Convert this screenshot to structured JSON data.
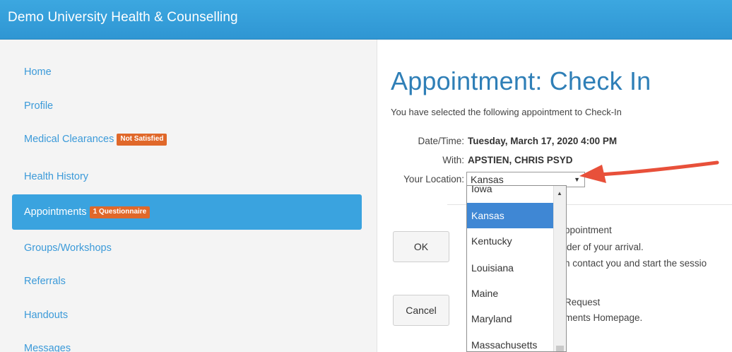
{
  "header": {
    "title": "Demo University Health & Counselling"
  },
  "sidebar": {
    "items": [
      {
        "label": "Home",
        "badge": ""
      },
      {
        "label": "Profile",
        "badge": ""
      },
      {
        "label": "Medical Clearances",
        "badge": "Not Satisfied"
      },
      {
        "label": "Health History",
        "badge": ""
      },
      {
        "label": "Appointments",
        "badge": "1 Questionnaire",
        "active": true
      },
      {
        "label": "Groups/Workshops",
        "badge": ""
      },
      {
        "label": "Referrals",
        "badge": ""
      },
      {
        "label": "Handouts",
        "badge": ""
      },
      {
        "label": "Messages",
        "badge": ""
      }
    ]
  },
  "main": {
    "title": "Appointment: Check In",
    "intro": "You have selected the following appointment to Check-In",
    "datetime_label": "Date/Time:",
    "datetime_value": "Tuesday, March 17, 2020 4:00 PM",
    "with_label": "With:",
    "with_value": "APSTIEN, CHRIS PSYD",
    "location_label": "Your Location:",
    "location_value": "Kansas",
    "ok_button": "OK",
    "ok_text_1": "ppointment",
    "ok_text_2": "ider of your arrival.",
    "ok_text_3": "n contact you and start the sessio",
    "cancel_button": "Cancel",
    "cancel_text_1": "Request",
    "cancel_text_2": "ments Homepage."
  },
  "dropdown": {
    "options": [
      "Iowa",
      "Kansas",
      "Kentucky",
      "Louisiana",
      "Maine",
      "Maryland",
      "Massachusetts"
    ],
    "selected": "Kansas"
  },
  "colors": {
    "brand": "#2f96d3",
    "badge": "#e0682a",
    "arrow": "#e8503a",
    "selected": "#3f87d4"
  },
  "icons": {
    "select_caret": "caret-down-icon",
    "scroll_up": "caret-up-icon",
    "pointer": "red-arrow-icon"
  }
}
